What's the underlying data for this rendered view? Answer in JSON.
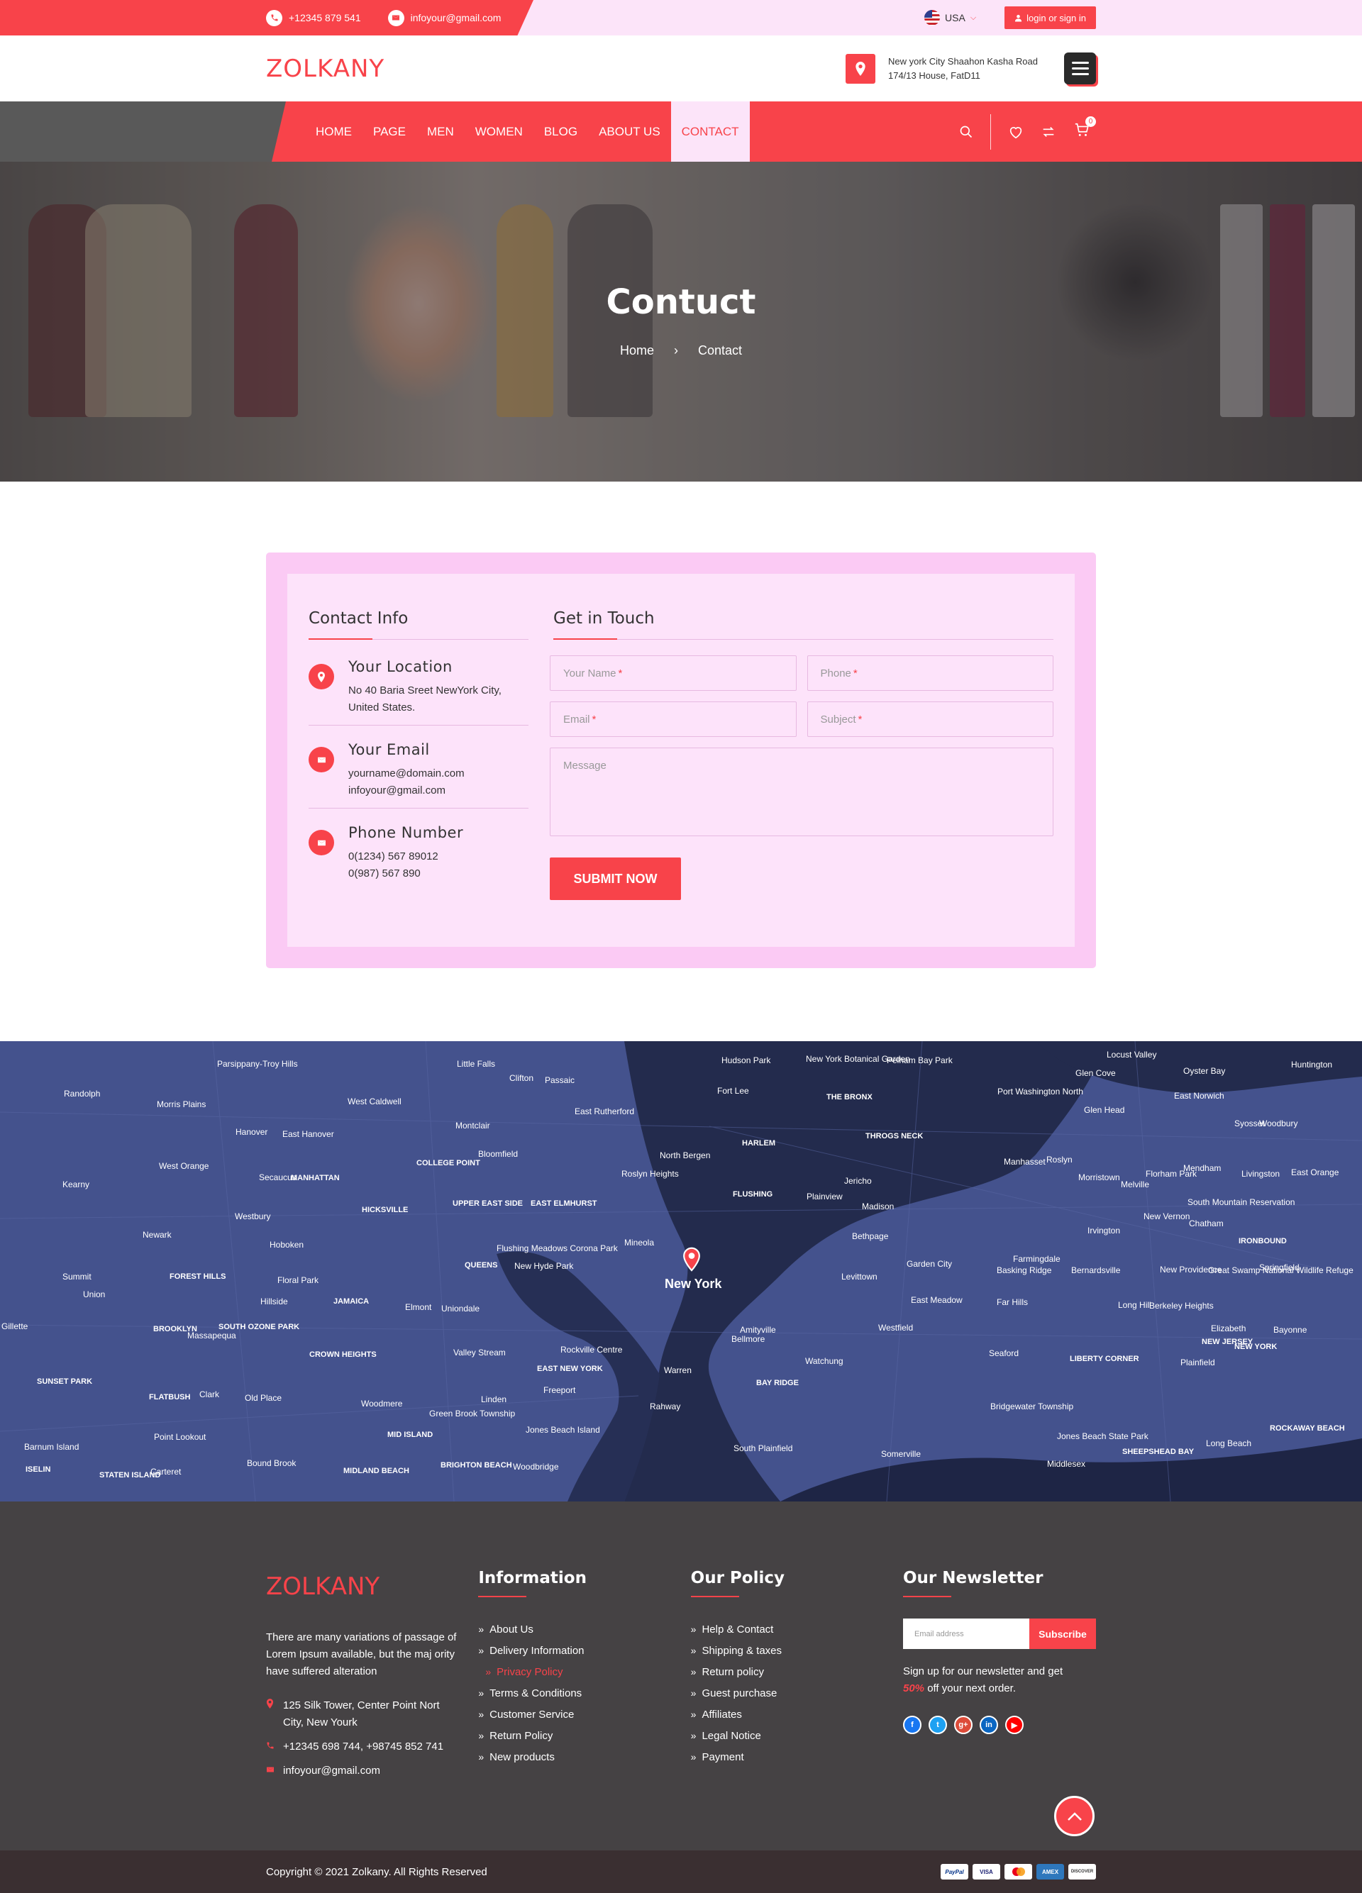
{
  "topbar": {
    "phone": "+12345 879 541",
    "email": "infoyour@gmail.com",
    "language": "USA",
    "login_label": "login or sign in"
  },
  "header": {
    "logo": "ZOLKANY",
    "address_line1": "New york City Shaahon Kasha Road",
    "address_line2": "174/13 House, FatD11"
  },
  "nav": {
    "items": [
      "HOME",
      "PAGE",
      "MEN",
      "WOMEN",
      "BLOG",
      "ABOUT US",
      "CONTACT"
    ],
    "active": "CONTACT",
    "cart_count": "0"
  },
  "hero": {
    "title": "Contuct",
    "breadcrumb_home": "Home",
    "breadcrumb_current": "Contact"
  },
  "contact_info": {
    "heading": "Contact Info",
    "location_title": "Your Location",
    "location_line1": "No 40 Baria Sreet NewYork City,",
    "location_line2": "United States.",
    "email_title": "Your Email",
    "email_line1": "yourname@domain.com",
    "email_line2": "infoyour@gmail.com",
    "phone_title": "Phone Number",
    "phone_line1": "0(1234) 567 89012",
    "phone_line2": "0(987) 567 890"
  },
  "form": {
    "heading": "Get in Touch",
    "name_placeholder": "Your Name",
    "phone_placeholder": "Phone",
    "email_placeholder": "Email",
    "subject_placeholder": "Subject",
    "required_mark": "*",
    "message_placeholder": "Message",
    "submit_label": "SUBMIT NOW"
  },
  "map": {
    "pin_label": "New York",
    "labels": [
      "Parsippany-Troy Hills",
      "Little Falls",
      "Clifton",
      "Passaic",
      "Hudson Park",
      "New York Botanical Garden",
      "Pelham Bay Park",
      "Locust Valley",
      "Glen Cove",
      "Oyster Bay",
      "Huntington",
      "Randolph",
      "Morris Plains",
      "West Caldwell",
      "Montclair",
      "East Rutherford",
      "Fort Lee",
      "THE BRONX",
      "Port Washington North",
      "Glen Head",
      "East Norwich",
      "Syosset",
      "Woodbury",
      "Hanover",
      "East Hanover",
      "Bloomfield",
      "North Bergen",
      "HARLEM",
      "THROGS NECK",
      "Manhasset",
      "Roslyn",
      "Morristown",
      "Florham Park",
      "Livingston",
      "West Orange",
      "Secaucus",
      "MANHATTAN",
      "COLLEGE POINT",
      "Roslyn Heights",
      "Jericho",
      "Melville",
      "Mendham",
      "East Orange",
      "Kearny",
      "UPPER EAST SIDE",
      "EAST ELMHURST",
      "FLUSHING",
      "Plainview",
      "Madison",
      "South Mountain Reservation",
      "Westbury",
      "HICKSVILLE",
      "New Vernon",
      "Chatham",
      "Newark",
      "Hoboken",
      "Flushing Meadows Corona Park",
      "Mineola",
      "Bethpage",
      "Irvington",
      "IRONBOUND",
      "QUEENS",
      "New Hyde Park",
      "Garden City",
      "Farmingdale",
      "Bernardsville",
      "Great Swamp National Wildlife Refuge",
      "Summit",
      "FOREST HILLS",
      "Floral Park",
      "Levittown",
      "Basking Ridge",
      "New Providence",
      "Springfield",
      "Union",
      "Hillside",
      "JAMAICA",
      "Elmont",
      "Uniondale",
      "East Meadow",
      "Far Hills",
      "Long Hill",
      "Berkeley Heights",
      "Gillette",
      "BROOKLYN",
      "SOUTH OZONE PARK",
      "Massapequa",
      "Amityville",
      "Westfield",
      "Elizabeth",
      "Bayonne",
      "CROWN HEIGHTS",
      "Valley Stream",
      "Rockville Centre",
      "Bellmore",
      "Seaford",
      "LIBERTY CORNER",
      "NEW JERSEY",
      "NEW YORK",
      "SUNSET PARK",
      "EAST NEW YORK",
      "Freeport",
      "Warren",
      "Watchung",
      "Plainfield",
      "FLATBUSH",
      "Clark",
      "Old Place",
      "BAY RIDGE",
      "Woodmere",
      "Linden",
      "Rahway",
      "Bridgewater Township",
      "Green Brook Township",
      "MID ISLAND",
      "Barnum Island",
      "Point Lookout",
      "Jones Beach Island",
      "Jones Beach State Park",
      "SHEEPSHEAD BAY",
      "ROCKAWAY BEACH",
      "Long Beach",
      "South Plainfield",
      "Somerville",
      "Middlesex",
      "Bound Brook",
      "ISELIN",
      "Carteret",
      "STATEN ISLAND",
      "MIDLAND BEACH",
      "BRIGHTON BEACH",
      "Woodbridge"
    ]
  },
  "footer": {
    "logo": "ZOLKANY",
    "about_text": "There are many variations of passage of Lorem Ipsum available, but the maj ority have suffered alteration",
    "address_line1": "125 Silk Tower, Center Point Nort",
    "address_line2": "City, New Yourk",
    "phones": "+12345 698 744, +98745 852 741",
    "email": "infoyour@gmail.com",
    "info_heading": "Information",
    "info_items": [
      "About Us",
      "Delivery Information",
      "Privacy Policy",
      "Terms & Conditions",
      "Customer Service",
      "Return Policy",
      "New products"
    ],
    "policy_heading": "Our Policy",
    "policy_items": [
      "Help & Contact",
      "Shipping & taxes",
      "Return policy",
      "Guest purchase",
      "Affiliates",
      "Legal Notice",
      "Payment"
    ],
    "newsletter_heading": "Our Newsletter",
    "newsletter_placeholder": "Email address",
    "subscribe_label": "Subscribe",
    "newsletter_text_pre": "Sign up for our newsletter and get",
    "newsletter_discount": "50%",
    "newsletter_text_post": "off your next order.",
    "copyright": "Copyright © 2021 Zolkany. All Rights Reserved",
    "payment_cards": [
      "PayPal",
      "VISA",
      "MC",
      "AMEX",
      "DISCOVER"
    ]
  },
  "colors": {
    "accent": "#f8434a",
    "pink_light": "#fce4f9",
    "pink": "#fbcaf4",
    "footer_bg": "#454244",
    "map_bg": "#3d4b85"
  }
}
